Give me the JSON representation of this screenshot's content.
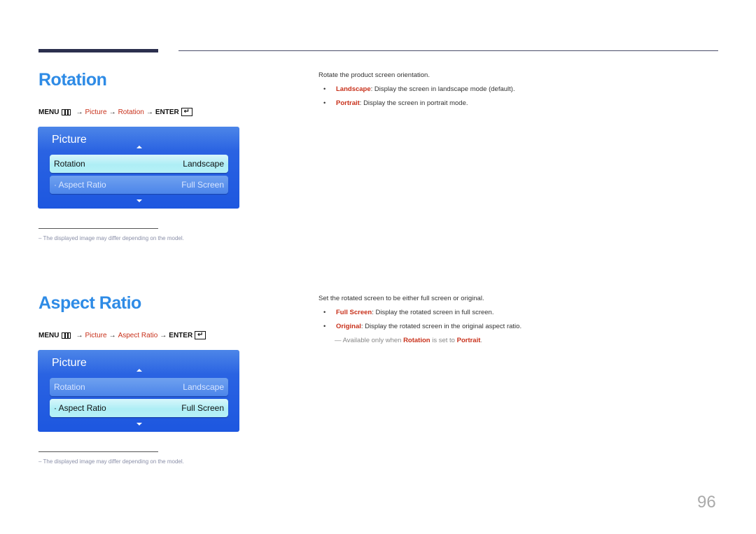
{
  "page_number": "96",
  "sections": [
    {
      "title": "Rotation",
      "path": {
        "menu": "MENU",
        "menu_icon": "menu-icon",
        "arrow": "→",
        "items": [
          "Picture",
          "Rotation"
        ],
        "enter": "ENTER",
        "enter_icon": "enter-icon",
        "enter_glyph": "↵"
      },
      "osd": {
        "title": "Picture",
        "rows": [
          {
            "label": "Rotation",
            "value": "Landscape",
            "selected": true
          },
          {
            "label": "· Aspect Ratio",
            "value": "Full Screen",
            "selected": false
          }
        ]
      },
      "footnote": "–  The displayed image may differ depending on the model.",
      "description": "Rotate the product screen orientation.",
      "bullets": [
        {
          "dot": "•",
          "keyword": "Landscape",
          "text": ": Display the screen in landscape mode (default)."
        },
        {
          "dot": "•",
          "keyword": "Portrait",
          "text": ": Display the screen in portrait mode."
        }
      ]
    },
    {
      "title": "Aspect Ratio",
      "path": {
        "menu": "MENU",
        "arrow": "→",
        "items": [
          "Picture",
          "Aspect Ratio"
        ],
        "enter": "ENTER",
        "enter_glyph": "↵"
      },
      "osd": {
        "title": "Picture",
        "rows": [
          {
            "label": "Rotation",
            "value": "Landscape",
            "selected": false
          },
          {
            "label": "· Aspect Ratio",
            "value": "Full Screen",
            "selected": true
          }
        ]
      },
      "footnote": "–  The displayed image may differ depending on the model.",
      "description": "Set the rotated screen to be either full screen or original.",
      "bullets": [
        {
          "dot": "•",
          "keyword": "Full Screen",
          "text": ": Display the rotated screen in full screen."
        },
        {
          "dot": "•",
          "keyword": "Original",
          "text": ": Display the rotated screen in the original aspect ratio."
        }
      ],
      "note": {
        "prefix": "— Available only when ",
        "kw1": "Rotation",
        "mid": " is set to ",
        "kw2": "Portrait",
        "suffix": "."
      }
    }
  ]
}
